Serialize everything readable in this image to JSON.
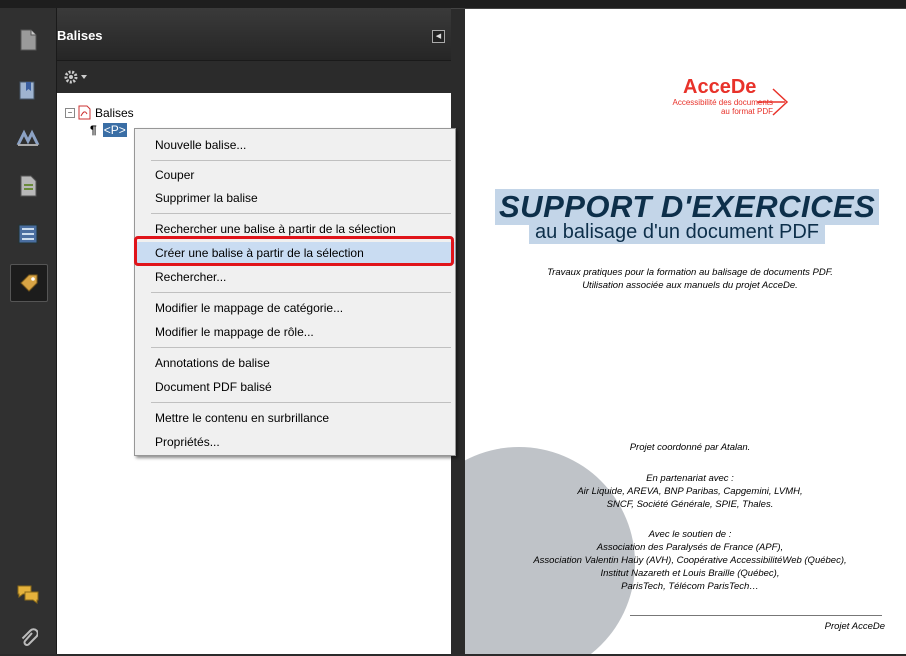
{
  "panel": {
    "title": "Balises",
    "collapse_icon": "triangle-left-icon"
  },
  "tree": {
    "root_label": "Balises",
    "child_label": "<P>"
  },
  "context_menu": {
    "items": [
      {
        "label": "Nouvelle balise..."
      },
      {
        "label": "Couper"
      },
      {
        "label": "Supprimer la balise"
      },
      {
        "label": "Rechercher une balise à partir de la sélection"
      },
      {
        "label": "Créer une balise à partir de la sélection",
        "highlighted": true
      },
      {
        "label": "Rechercher..."
      },
      {
        "label": "Modifier le mappage de catégorie..."
      },
      {
        "label": "Modifier le mappage de rôle..."
      },
      {
        "label": "Annotations de balise"
      },
      {
        "label": "Document PDF balisé"
      },
      {
        "label": "Mettre le contenu en surbrillance"
      },
      {
        "label": "Propriétés..."
      }
    ]
  },
  "sidebar_icons": [
    "pages-icon",
    "bookmarks-icon",
    "signatures-icon",
    "content-icon",
    "order-icon",
    "tags-icon",
    "comments-icon",
    "attachments-icon"
  ],
  "document": {
    "logo_title": "AcceDe",
    "logo_sub_1": "Accessibilité des documents",
    "logo_sub_2": "au format PDF",
    "title": "SUPPORT D'EXERCICES",
    "subtitle": "au balisage d'un document PDF",
    "desc_1": "Travaux pratiques pour la formation au balisage de documents PDF.",
    "desc_2": "Utilisation associée aux manuels du projet AcceDe.",
    "coord": "Projet coordonné par Atalan.",
    "partners_heading": "En partenariat avec :",
    "partners_1": "Air Liquide, AREVA, BNP Paribas, Capgemini, LVMH,",
    "partners_2": "SNCF, Société Générale, SPIE, Thales.",
    "support_heading": "Avec le soutien de :",
    "support_1": "Association des Paralysés de France (APF),",
    "support_2": "Association Valentin Haüy (AVH), Coopérative AccessibilitéWeb (Québec),",
    "support_3": "Institut Nazareth et Louis Braille (Québec),",
    "support_4": "ParisTech, Télécom ParisTech…",
    "footer": "Projet AcceDe"
  },
  "colors": {
    "accent_red": "#e8322a",
    "highlight_bg": "#c3d5e8",
    "menu_highlight": "#c9dcf2",
    "frame_red": "#e0141a"
  }
}
